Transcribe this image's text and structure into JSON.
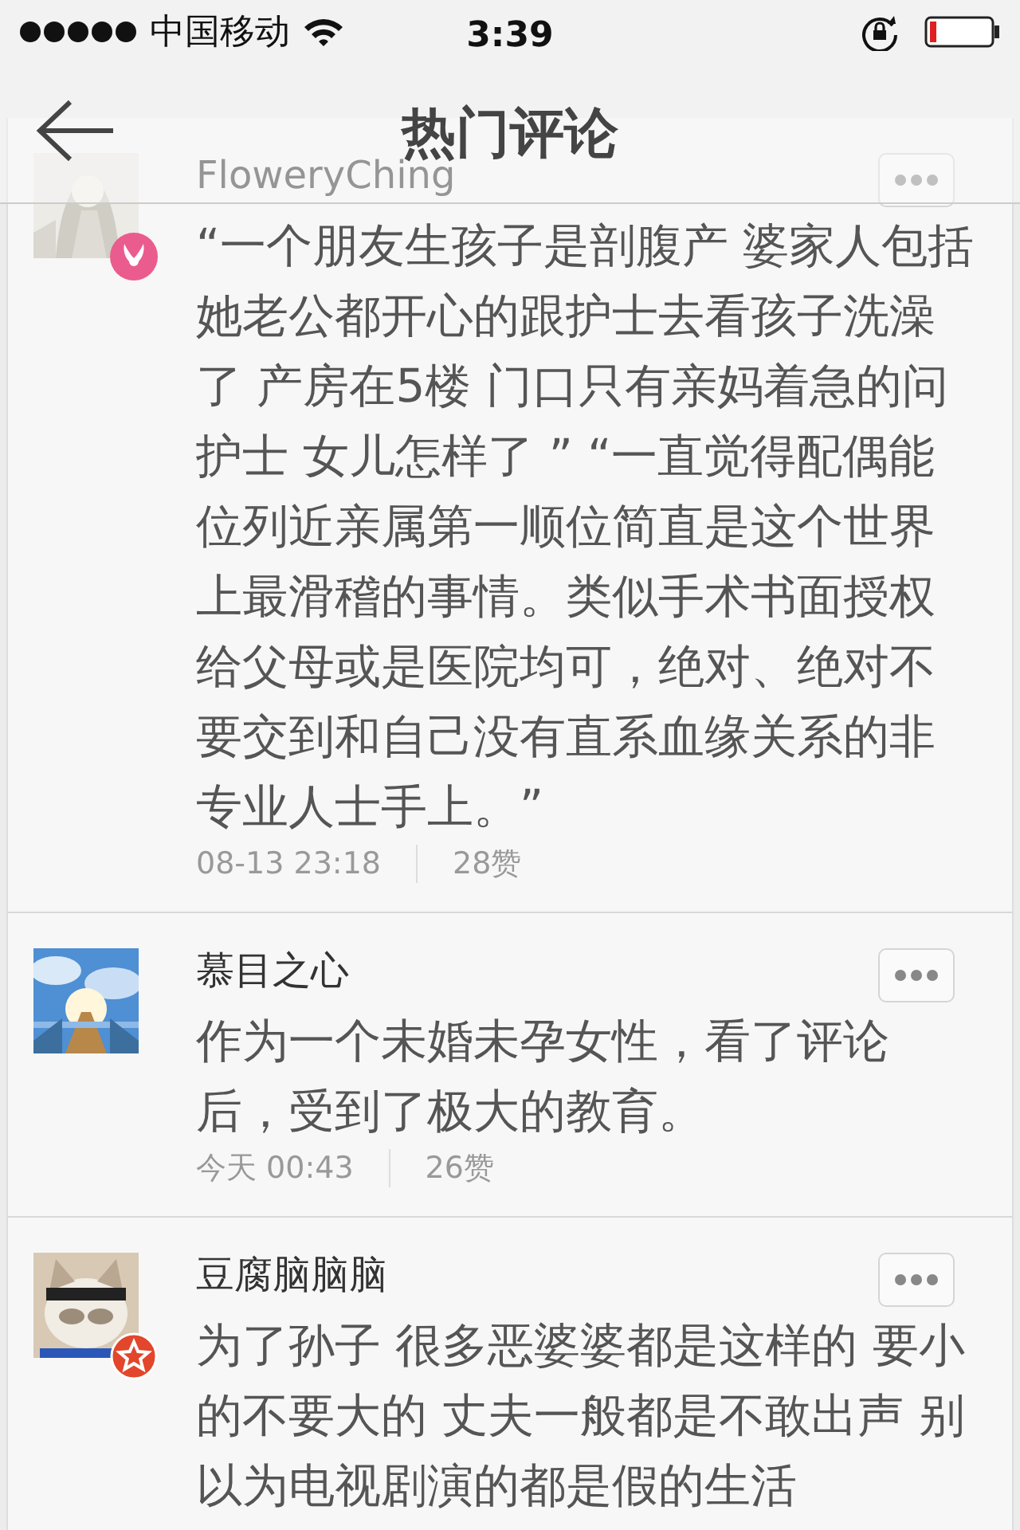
{
  "status_bar": {
    "carrier": "中国移动",
    "time": "3:39"
  },
  "nav": {
    "title": "热门评论"
  },
  "comments": [
    {
      "author": "FloweryChing",
      "badge": {
        "kind": "vip"
      },
      "text": "“一个朋友生孩子是剖腹产 婆家人包括她老公都开心的跟护士去看孩子洗澡了 产房在5楼 门口只有亲妈着急的问护士 女儿怎样了 ” “一直觉得配偶能位列近亲属第一顺位简直是这个世界上最滑稽的事情。类似手术书面授权给父母或是医院均可，绝对、绝对不要交到和自己没有直系血缘关系的非专业人士手上。”",
      "time": "08-13 23:18",
      "likes": "28赞"
    },
    {
      "author": "慕目之心",
      "text": "作为一个未婚未孕女性，看了评论后，受到了极大的教育。",
      "time": "今天 00:43",
      "likes": "26赞"
    },
    {
      "author": "豆腐脑脑脑",
      "badge": {
        "kind": "star"
      },
      "text": "为了孙子 很多恶婆婆都是这样的 要小的不要大的 丈夫一般都是不敢出声 别以为电视剧演的都是假的生活"
    }
  ]
}
